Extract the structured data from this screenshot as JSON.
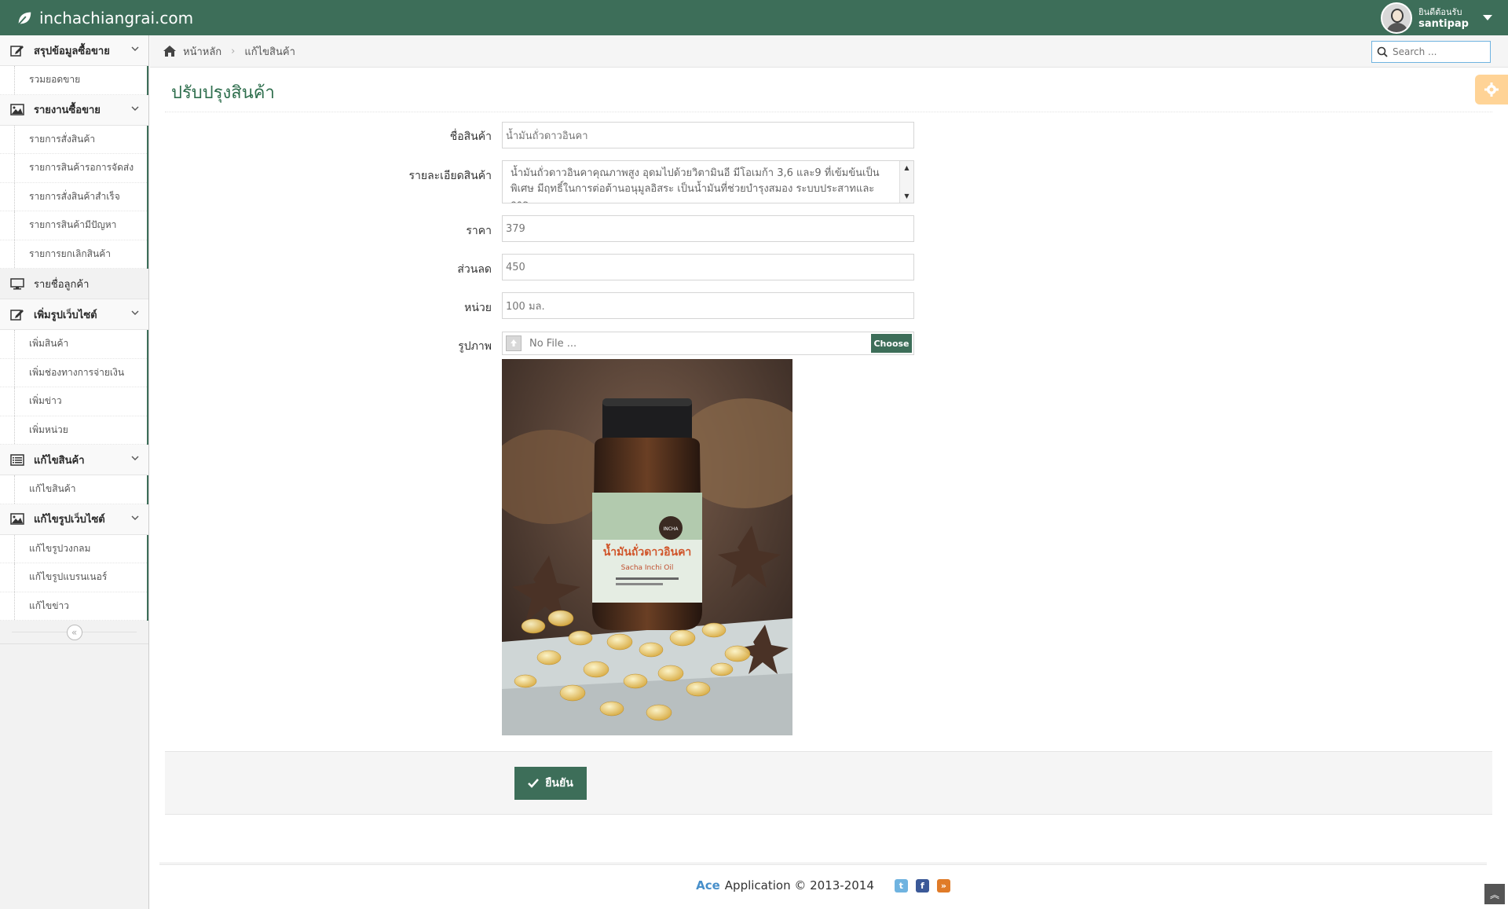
{
  "colors": {
    "primary": "#3d6e59",
    "link_blue": "#478fca",
    "settings_orange": "#ffb752"
  },
  "navbar": {
    "brand": "inchachiangrai.com",
    "welcome": "ยินดีต้อนรับ",
    "username": "santipap"
  },
  "sidebar": {
    "groups": [
      {
        "label": "สรุปข้อมูลซื้อขาย",
        "icon": "edit-icon",
        "items": [
          "รวมยอดขาย"
        ]
      },
      {
        "label": "รายงานซื้อขาย",
        "icon": "picture-icon",
        "items": [
          "รายการสั่งสินค้า",
          "รายการสินค้ารอการจัดส่ง",
          "รายการสั่งสินค้าสำเร็จ",
          "รายการสินค้ามีปัญหา",
          "รายการยกเลิกสินค้า"
        ]
      },
      {
        "label": "รายชื่อลูกค้า",
        "icon": "desktop-icon",
        "items": []
      },
      {
        "label": "เพิ่มรูปเว็บไซต์",
        "icon": "edit-icon",
        "items": [
          "เพิ่มสินค้า",
          "เพิ่มช่องทางการจ่ายเงิน",
          "เพิ่มข่าว",
          "เพิ่มหน่วย"
        ]
      },
      {
        "label": "แก้ไขสินค้า",
        "icon": "list-icon",
        "items": [
          "แก้ไขสินค้า"
        ]
      },
      {
        "label": "แก้ไขรูปเว็บไซต์",
        "icon": "picture-icon",
        "items": [
          "แก้ไขรูปวงกลม",
          "แก้ไขรูปแบรนเนอร์",
          "แก้ไขข่าว"
        ]
      }
    ]
  },
  "breadcrumb": {
    "home": "หน้าหลัก",
    "current": "แก้ไขสินค้า"
  },
  "search": {
    "placeholder": "Search ..."
  },
  "page": {
    "title": "ปรับปรุงสินค้า"
  },
  "form": {
    "name_label": "ชื่อสินค้า",
    "name_value": "น้ำมันถั่วดาวอินคา",
    "detail_label": "รายละเอียดสินค้า",
    "detail_value": "น้ำมันถั่วดาวอินคาคุณภาพสูง อุดมไปด้วยวิตามินอี มีโอเมก้า 3,6 และ9 ที่เข้มข้นเป็นพิเศษ มีฤทธิ์ในการต่อต้านอนุมูลอิสระ เป็นน้ำมันที่ช่วยบำรุงสมอง ระบบประสาทและการ",
    "price_label": "ราคา",
    "price_value": "379",
    "discount_label": "ส่วนลด",
    "discount_value": "450",
    "unit_label": "หน่วย",
    "unit_value": "100 มล.",
    "image_label": "รูปภาพ",
    "file_text": "No File ...",
    "choose_label": "Choose",
    "bottle_label": "น้ำมันถั่วดาวอินคา",
    "bottle_sub": "Sacha Inchi Oil",
    "bottle_brand": "INCHA",
    "confirm_label": "ยืนยัน"
  },
  "footer": {
    "brand": "Ace",
    "text": "Application © 2013-2014"
  }
}
